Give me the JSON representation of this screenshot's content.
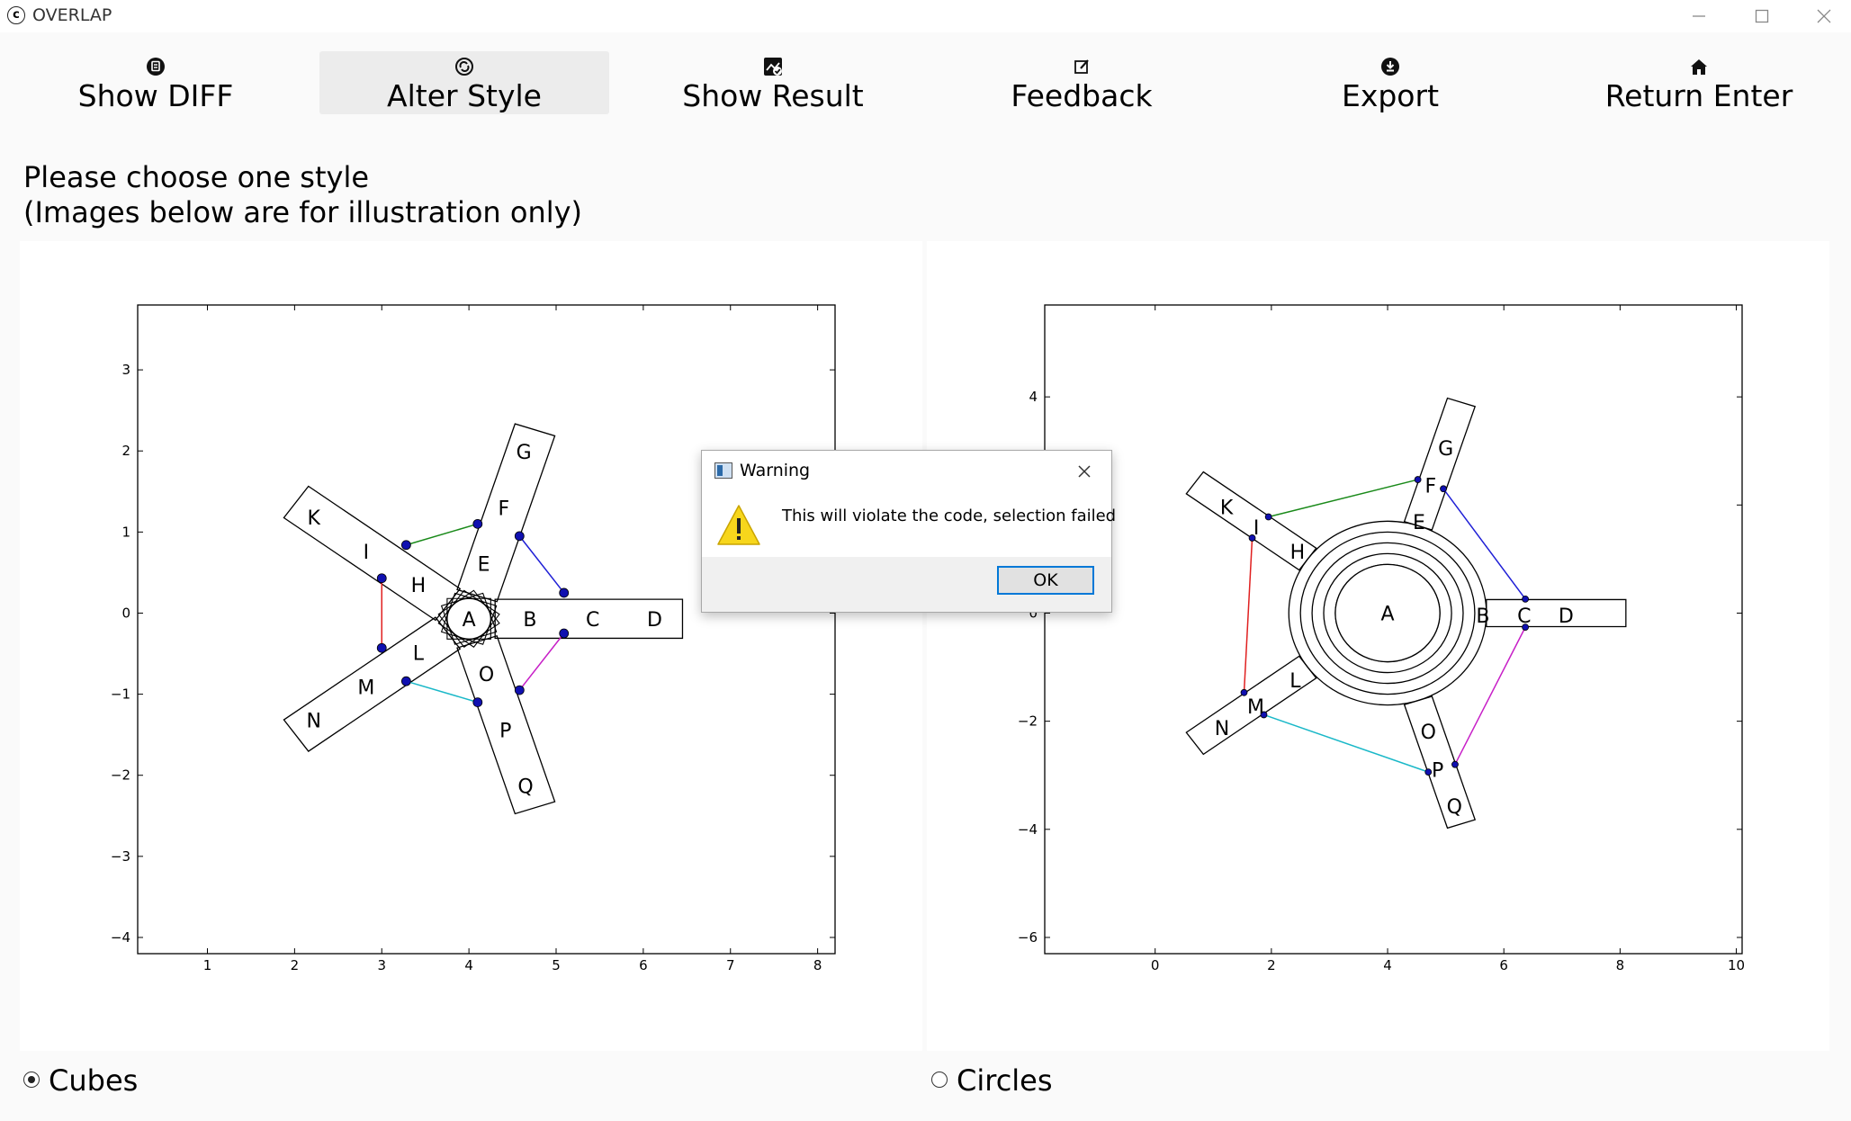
{
  "window": {
    "title": "OVERLAP",
    "controls": [
      "minimize",
      "maximize",
      "close"
    ]
  },
  "toolbar": {
    "buttons": [
      {
        "label": "Show DIFF",
        "icon": "diff-icon"
      },
      {
        "label": "Alter Style",
        "icon": "style-icon"
      },
      {
        "label": "Show Result",
        "icon": "result-icon"
      },
      {
        "label": "Feedback",
        "icon": "edit-icon"
      },
      {
        "label": "Export",
        "icon": "download-icon"
      },
      {
        "label": "Return Enter",
        "icon": "home-icon"
      }
    ],
    "active": "Alter Style"
  },
  "prompt": {
    "line1": "Please choose one style",
    "line2": "(Images below are for illustration only)"
  },
  "options": [
    {
      "label": "Cubes",
      "selected": true
    },
    {
      "label": "Circles",
      "selected": false
    }
  ],
  "dialog": {
    "title": "Warning",
    "message": "This will violate the code, selection failed",
    "ok_label": "OK",
    "icon": "warning-icon"
  },
  "chart_data": [
    {
      "type": "diagram",
      "style": "Cubes",
      "xlim": [
        0.2,
        8.2
      ],
      "ylim": [
        -4.2,
        3.8
      ],
      "xticks": [
        1,
        2,
        3,
        4,
        5,
        6,
        7,
        8
      ],
      "yticks": [
        -4,
        -3,
        -2,
        -1,
        0,
        1,
        2,
        3
      ],
      "xtick_labels": [
        "1",
        "2",
        "3",
        "4",
        "5",
        "6",
        "7",
        "8"
      ],
      "ytick_labels": [
        "−4",
        "−3",
        "−2",
        "−1",
        "0",
        "1",
        "2",
        "3"
      ],
      "center": {
        "label": "A",
        "x": 4.0,
        "y": -0.07
      },
      "node_labels": [
        {
          "t": "B",
          "x": 4.7,
          "y": -0.07
        },
        {
          "t": "C",
          "x": 5.42,
          "y": -0.07
        },
        {
          "t": "D",
          "x": 6.13,
          "y": -0.07
        },
        {
          "t": "E",
          "x": 4.17,
          "y": 0.61
        },
        {
          "t": "F",
          "x": 4.4,
          "y": 1.3
        },
        {
          "t": "G",
          "x": 4.63,
          "y": 1.99
        },
        {
          "t": "H",
          "x": 3.42,
          "y": 0.35
        },
        {
          "t": "I",
          "x": 2.82,
          "y": 0.76
        },
        {
          "t": "K",
          "x": 2.22,
          "y": 1.18
        },
        {
          "t": "L",
          "x": 3.42,
          "y": -0.49
        },
        {
          "t": "M",
          "x": 2.82,
          "y": -0.91
        },
        {
          "t": "N",
          "x": 2.22,
          "y": -1.32
        },
        {
          "t": "O",
          "x": 4.2,
          "y": -0.75
        },
        {
          "t": "P",
          "x": 4.42,
          "y": -1.44
        },
        {
          "t": "Q",
          "x": 4.65,
          "y": -2.13
        }
      ],
      "links": [
        {
          "from": [
            3.28,
            0.84
          ],
          "to": [
            4.1,
            1.1
          ],
          "color": "#1a8a1a"
        },
        {
          "from": [
            4.58,
            0.95
          ],
          "to": [
            5.09,
            0.25
          ],
          "color": "#1f1fd6"
        },
        {
          "from": [
            3.0,
            0.43
          ],
          "to": [
            3.0,
            -0.43
          ],
          "color": "#e02020"
        },
        {
          "from": [
            5.09,
            -0.25
          ],
          "to": [
            4.58,
            -0.95
          ],
          "color": "#c71fc7"
        },
        {
          "from": [
            3.28,
            -0.84
          ],
          "to": [
            4.1,
            -1.1
          ],
          "color": "#1ab8c8"
        }
      ]
    },
    {
      "type": "diagram",
      "style": "Circles",
      "xlim": [
        -1.9,
        10.1
      ],
      "ylim": [
        -6.3,
        5.7
      ],
      "xticks": [
        0,
        2,
        4,
        6,
        8,
        10
      ],
      "yticks": [
        -6,
        -4,
        -2,
        0,
        2,
        4
      ],
      "xtick_labels": [
        "0",
        "2",
        "4",
        "6",
        "8",
        "10"
      ],
      "ytick_labels": [
        "−6",
        "−4",
        "−2",
        "0",
        "2",
        "4"
      ],
      "center": {
        "label": "A",
        "x": 4.0,
        "y": 0.0
      },
      "rings": [
        0.9,
        1.1,
        1.3,
        1.5,
        1.7
      ],
      "node_labels": [
        {
          "t": "B",
          "x": 5.64,
          "y": -0.04
        },
        {
          "t": "C",
          "x": 6.35,
          "y": -0.04
        },
        {
          "t": "D",
          "x": 7.07,
          "y": -0.04
        },
        {
          "t": "E",
          "x": 4.54,
          "y": 1.69
        },
        {
          "t": "F",
          "x": 4.74,
          "y": 2.36
        },
        {
          "t": "G",
          "x": 5.0,
          "y": 3.05
        },
        {
          "t": "H",
          "x": 2.45,
          "y": 1.14
        },
        {
          "t": "I",
          "x": 1.74,
          "y": 1.59
        },
        {
          "t": "K",
          "x": 1.23,
          "y": 1.96
        },
        {
          "t": "L",
          "x": 2.41,
          "y": -1.24
        },
        {
          "t": "M",
          "x": 1.73,
          "y": -1.72
        },
        {
          "t": "N",
          "x": 1.15,
          "y": -2.12
        },
        {
          "t": "O",
          "x": 4.7,
          "y": -2.19
        },
        {
          "t": "P",
          "x": 4.86,
          "y": -2.9
        },
        {
          "t": "Q",
          "x": 5.15,
          "y": -3.57
        }
      ],
      "links": [
        {
          "from": [
            1.95,
            1.78
          ],
          "to": [
            4.52,
            2.47
          ],
          "color": "#1a8a1a"
        },
        {
          "from": [
            4.96,
            2.3
          ],
          "to": [
            6.37,
            0.26
          ],
          "color": "#1f1fd6"
        },
        {
          "from": [
            1.67,
            1.39
          ],
          "to": [
            1.53,
            -1.47
          ],
          "color": "#e02020"
        },
        {
          "from": [
            6.37,
            -0.26
          ],
          "to": [
            5.16,
            -2.8
          ],
          "color": "#c71fc7"
        },
        {
          "from": [
            1.87,
            -1.88
          ],
          "to": [
            4.7,
            -2.94
          ],
          "color": "#1ab8c8"
        }
      ]
    }
  ]
}
